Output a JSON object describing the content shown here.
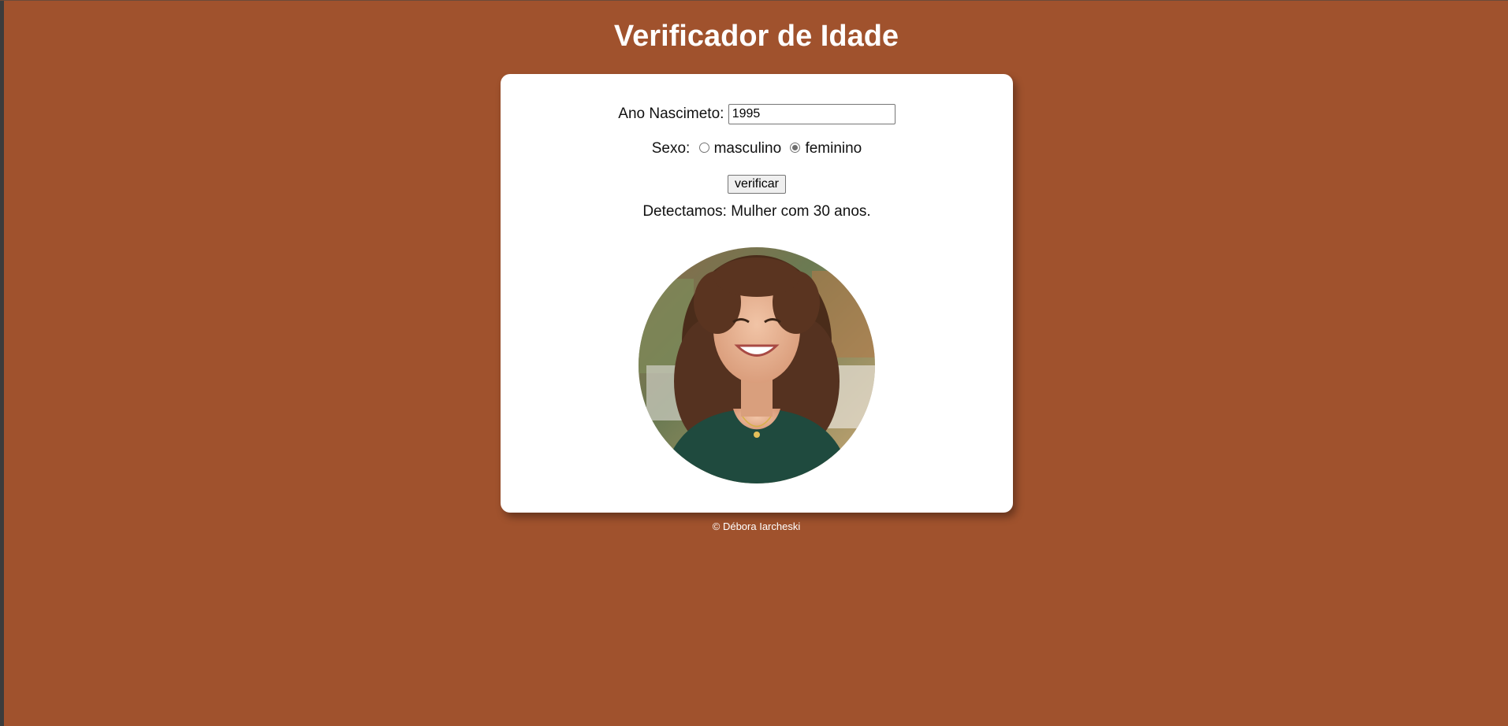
{
  "page": {
    "title": "Verificador de Idade",
    "background_color": "#a0522d"
  },
  "form": {
    "year_label": "Ano Nascimeto:",
    "year_value": "1995",
    "sex_label": "Sexo:",
    "sex_options": [
      {
        "label": "masculino",
        "checked": false
      },
      {
        "label": "feminino",
        "checked": true
      }
    ],
    "submit_label": "verificar"
  },
  "result": {
    "text": "Detectamos: Mulher com 30 anos.",
    "photo_icon": "woman-photo"
  },
  "footer": {
    "text": "© Débora Iarcheski"
  }
}
